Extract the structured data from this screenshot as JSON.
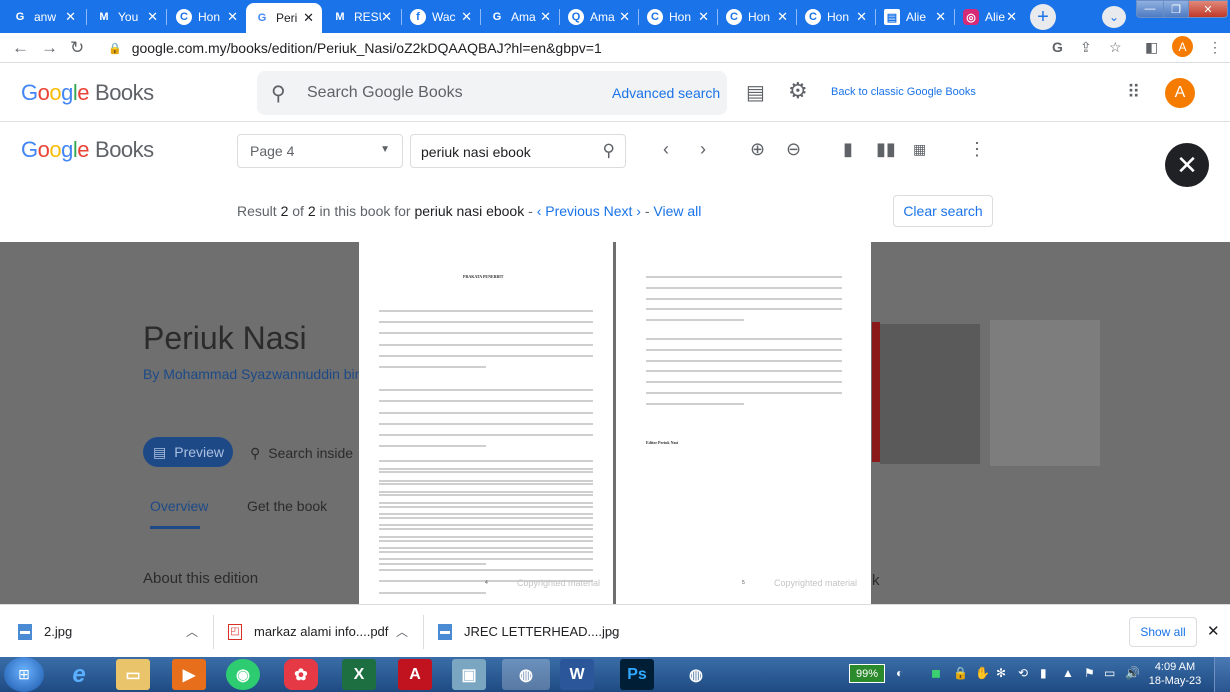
{
  "tabs": [
    {
      "title": "anw",
      "favicon": "G",
      "favicon_color": "#ffffff",
      "favicon_bg": "#1a73e8"
    },
    {
      "title": "You",
      "favicon": "M",
      "favicon_color": "#ea4335",
      "favicon_bg": "#ffffff"
    },
    {
      "title": "Hon",
      "favicon": "C",
      "favicon_color": "#1a73e8",
      "favicon_bg": "#ffffff"
    },
    {
      "title": "Peri",
      "favicon": "G",
      "favicon_color": "#4285f4",
      "favicon_bg": "#ffffff"
    },
    {
      "title": "RESU",
      "favicon": "M",
      "favicon_color": "#ea4335",
      "favicon_bg": "#ffffff"
    },
    {
      "title": "Wac",
      "favicon": "f",
      "favicon_color": "#ffffff",
      "favicon_bg": "#1877f2"
    },
    {
      "title": "Ama",
      "favicon": "G",
      "favicon_color": "#4285f4",
      "favicon_bg": "#ffffff"
    },
    {
      "title": "Ama",
      "favicon": "Q",
      "favicon_color": "#1a73e8",
      "favicon_bg": "#ffffff"
    },
    {
      "title": "Hon",
      "favicon": "C",
      "favicon_color": "#1a73e8",
      "favicon_bg": "#ffffff"
    },
    {
      "title": "Hon",
      "favicon": "C",
      "favicon_color": "#1a73e8",
      "favicon_bg": "#ffffff"
    },
    {
      "title": "Hon",
      "favicon": "C",
      "favicon_color": "#1a73e8",
      "favicon_bg": "#ffffff"
    },
    {
      "title": "Alie",
      "favicon": "▤",
      "favicon_color": "#1a73e8",
      "favicon_bg": "#ffffff"
    },
    {
      "title": "Alie",
      "favicon": "◎",
      "favicon_color": "#ffffff",
      "favicon_bg": "#d62976"
    }
  ],
  "address_bar": {
    "url": "google.com.my/books/edition/Periuk_Nasi/oZ2kDQAAQBAJ?hl=en&gbpv=1"
  },
  "profile_initial": "A",
  "header": {
    "logo": {
      "part1": "G",
      "part2": "o",
      "part3": "o",
      "part4": "g",
      "part5": "l",
      "part6": "e",
      "suffix": "Books"
    },
    "search_placeholder": "Search Google Books",
    "advanced_search": "Advanced search",
    "classic_link": "Back to classic Google Books",
    "avatar_initial": "A"
  },
  "reader": {
    "page_select": "Page 4",
    "search_value": "periuk nasi ebook"
  },
  "result": {
    "prefix": "Result",
    "index": "2",
    "of_word": "of",
    "total": "2",
    "middle": "in this book for",
    "query": "periuk nasi ebook",
    "dash": "-",
    "previous": "‹ Previous",
    "next": "Next ›",
    "dash2": "-",
    "view_all": "View all",
    "clear_search": "Clear search"
  },
  "book": {
    "title": "Periuk Nasi",
    "author": "By Mohammad Syazwannuddin bin",
    "preview": "Preview",
    "search_inside": "Search inside",
    "tab_overview": "Overview",
    "tab_get_book": "Get the book",
    "about_edition": "About this edition",
    "partial_char": "k"
  },
  "pages": {
    "left_title": "PRAKATA PENERBIT",
    "left_page_number": "4",
    "right_page_number": "5",
    "right_signature": "Editor Periuk Nasi",
    "copyright": "Copyrighted material"
  },
  "downloads": [
    {
      "name": "2.jpg",
      "icon": "image-file-icon"
    },
    {
      "name": "markaz alami info....pdf",
      "icon": "pdf-file-icon"
    },
    {
      "name": "JREC LETTERHEAD....jpg",
      "icon": "image-file-icon"
    }
  ],
  "show_all": "Show all",
  "taskbar": {
    "battery": "99%",
    "time": "4:09 AM",
    "date": "18-May-23",
    "apps": [
      "ie-icon",
      "explorer-icon",
      "media-player-icon",
      "browser-icon",
      "app-icon",
      "excel-icon",
      "acrobat-icon",
      "photos-icon",
      "chrome-icon",
      "word-icon",
      "photoshop-icon",
      "chrome-profile-icon"
    ]
  },
  "colors": {
    "accent": "#1a73e8",
    "tabstrip": "#1a73e8",
    "overlay": "#6f6f6f"
  }
}
